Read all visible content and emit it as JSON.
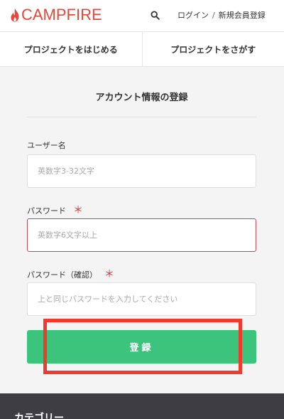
{
  "header": {
    "logo_text": "CAMPFIRE",
    "login_label": "ログイン",
    "separator": "/",
    "register_label": "新規会員登録"
  },
  "tabs": [
    {
      "label": "プロジェクトをはじめる"
    },
    {
      "label": "プロジェクトをさがす"
    }
  ],
  "form": {
    "title": "アカウント情報の登録",
    "username_label": "ユーザー名",
    "username_placeholder": "英数字3-32文字",
    "password_label": "パスワード",
    "password_placeholder": "英数字6文字以上",
    "password_confirm_label": "パスワード（確認）",
    "password_confirm_placeholder": "上と同じパスワードを入力してください",
    "required_mark": "＊",
    "submit_label": "登録"
  },
  "footer": {
    "category_title": "カテゴリー"
  },
  "colors": {
    "brand": "#e8473a",
    "submit": "#3cc47c",
    "error_border": "#c2494f",
    "required": "#d9333f",
    "highlight": "#f03a2e",
    "footer_bg": "#3d3d43"
  },
  "icons": [
    "flame-icon",
    "search-icon"
  ]
}
